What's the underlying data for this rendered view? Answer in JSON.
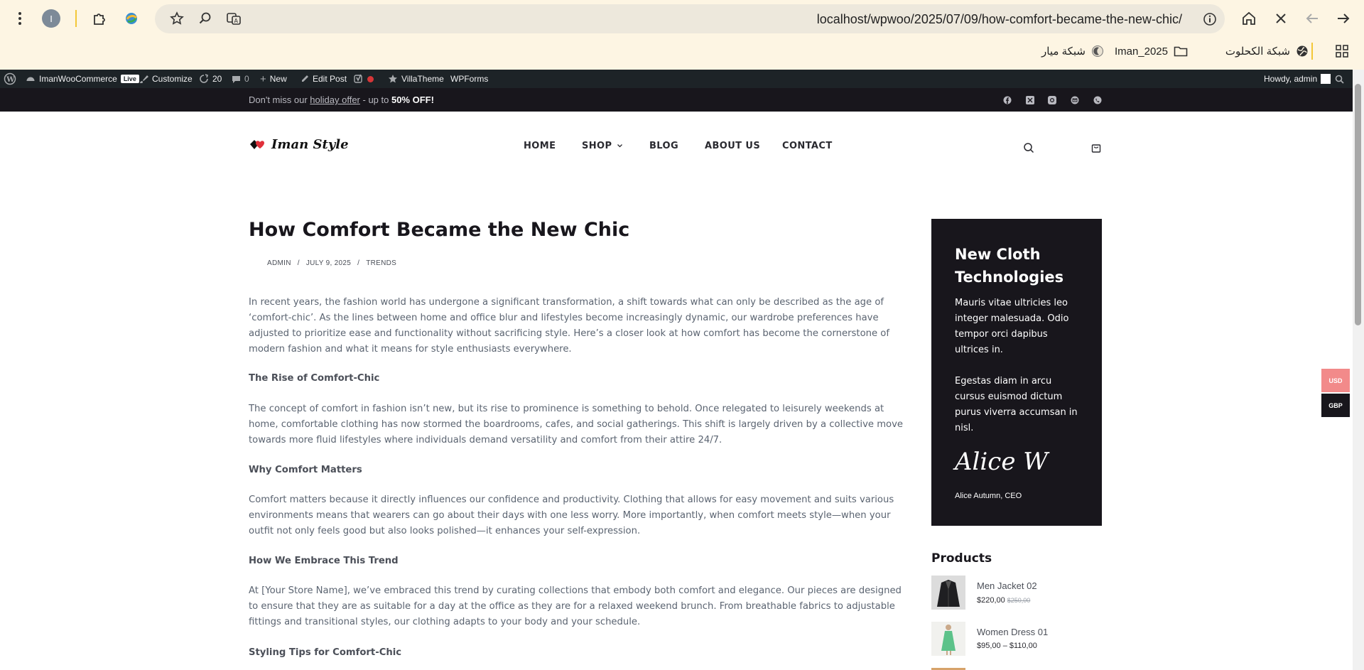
{
  "browser": {
    "url": "localhost/wpwoo/2025/07/09/how-comfort-became-the-new-chic/",
    "profile_initial": "I",
    "bookmarks": [
      "شبكة الكحلوت",
      "Iman_2025",
      "شبكة ميار"
    ]
  },
  "admin_bar": {
    "site_name": "ImanWooCommerce",
    "live_badge": "Live",
    "customize": "Customize",
    "updates_count": "20",
    "comments_count": "0",
    "new": "New",
    "edit_post": "Edit Post",
    "villatheme": "VillaTheme",
    "wpforms": "WPForms",
    "howdy": "Howdy, admin"
  },
  "notice": {
    "prefix": "Don't miss our ",
    "link": "holiday offer",
    "middle": " - up to ",
    "highlight": "50% OFF!"
  },
  "site": {
    "logo_text": "Iman Style",
    "nav": [
      "HOME",
      "SHOP",
      "BLOG",
      "ABOUT US",
      "CONTACT"
    ]
  },
  "post": {
    "title": "How Comfort Became the New Chic",
    "author": "ADMIN",
    "date": "JULY 9, 2025",
    "category": "TRENDS",
    "intro": "In recent years, the fashion world has undergone a significant transformation, a shift towards what can only be described as the age of ‘comfort-chic’. As the lines between home and office blur and lifestyles become increasingly dynamic, our wardrobe preferences have adjusted to prioritize ease and functionality without sacrificing style. Here’s a closer look at how comfort has become the cornerstone of modern fashion and what it means for style enthusiasts everywhere.",
    "h1": "The Rise of Comfort-Chic",
    "p1": "The concept of comfort in fashion isn’t new, but its rise to prominence is something to behold. Once relegated to leisurely weekends at home, comfortable clothing has now stormed the boardrooms, cafes, and social gatherings. This shift is largely driven by a collective move towards more fluid lifestyles where individuals demand versatility and comfort from their attire 24/7.",
    "h2": "Why Comfort Matters",
    "p2": "Comfort matters because it directly influences our confidence and productivity. Clothing that allows for easy movement and suits various environments means that wearers can go about their days with one less worry. More importantly, when comfort meets style—when your outfit not only feels good but also looks polished—it enhances your self-expression.",
    "h3": "How We Embrace This Trend",
    "p3": "At [Your Store Name], we’ve embraced this trend by curating collections that embody both comfort and elegance. Our pieces are designed to ensure that they are as suitable for a day at the office as they are for a relaxed weekend brunch. From breathable fabrics to adjustable fittings and transitional styles, our clothing adapts to your body and your schedule.",
    "h4": "Styling Tips for Comfort-Chic"
  },
  "sidebar": {
    "promo_title": "New Cloth Technologies",
    "promo_p1": "Mauris vitae ultricies leo integer malesuada. Odio tempor orci dapibus ultrices in.",
    "promo_p2": "Egestas diam in arcu cursus euismod dictum purus viverra accumsan in nisl.",
    "signature": "Alice W",
    "signer": "Alice Autumn, CEO",
    "products_heading": "Products",
    "products": [
      {
        "name": "Men Jacket 02",
        "price": "$220,00",
        "old_price": "$250,00"
      },
      {
        "name": "Women Dress 01",
        "price": "$95,00 – $110,00"
      }
    ]
  },
  "currency": [
    "USD",
    "GBP"
  ]
}
